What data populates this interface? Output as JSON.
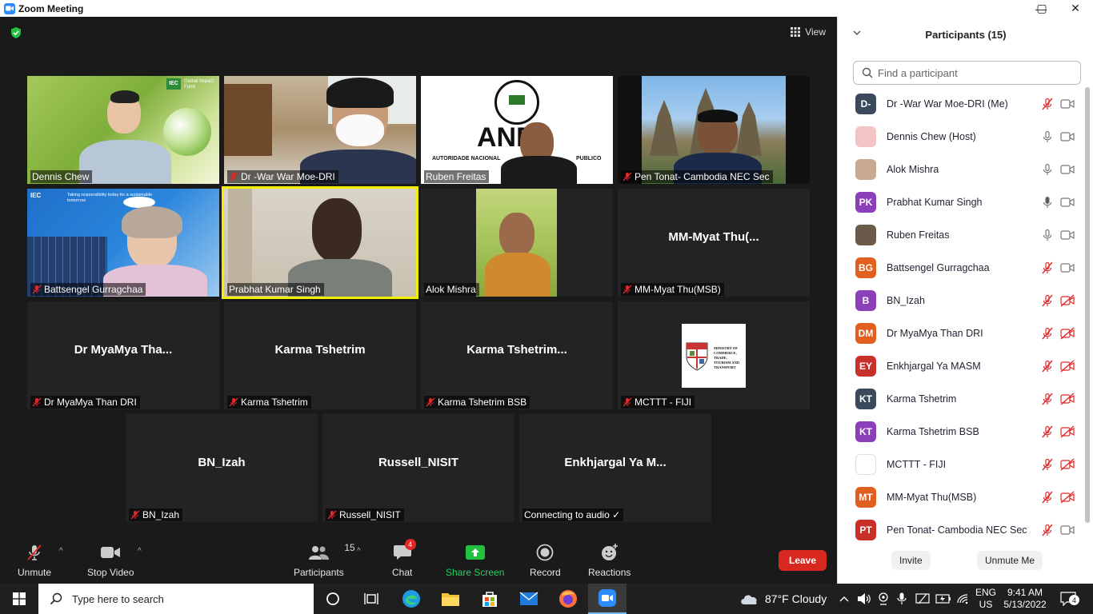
{
  "window": {
    "title": "Zoom Meeting",
    "minimize": "—",
    "maximize": "▢",
    "close": "✕"
  },
  "meeting": {
    "view_label": "View"
  },
  "tiles": [
    {
      "name": "Dennis Chew",
      "big": ""
    },
    {
      "name": "Dr -War War Moe-DRI",
      "big": ""
    },
    {
      "name": "Ruben Freitas",
      "big": ""
    },
    {
      "name": "Pen Tonat- Cambodia NEC Sec",
      "big": ""
    },
    {
      "name": "Battsengel Gurragchaa",
      "big": ""
    },
    {
      "name": "Prabhat Kumar Singh",
      "big": ""
    },
    {
      "name": "Alok Mishra",
      "big": ""
    },
    {
      "name": "MM-Myat Thu(MSB)",
      "big": "MM-Myat  Thu(..."
    },
    {
      "name": "Dr MyaMya Than DRI",
      "big": "Dr MyaMya  Tha..."
    },
    {
      "name": "Karma Tshetrim",
      "big": "Karma  Tshetrim"
    },
    {
      "name": "Karma Tshetrim BSB",
      "big": "Karma  Tshetrim..."
    },
    {
      "name": "MCTTT - FIJI",
      "big": ""
    },
    {
      "name": "BN_Izah",
      "big": "BN_Izah"
    },
    {
      "name": "Russell_NISIT",
      "big": "Russell_NISIT"
    },
    {
      "name": "Connecting to audio ✓",
      "big": "Enkhjargal  Ya  M..."
    }
  ],
  "tile_texts": {
    "iec_small": "IEC",
    "global_fund": "Global Impact Fund",
    "ane": "ANE",
    "ane_sub": "AUTORIDADE NACIONAL",
    "ane_sub2": "PUBLICO",
    "iec_banner": "Taking responsibility today for a sustainable tomorrow",
    "ministry": "MINISTRY OF COMMERCE, TRADE, TOURISM AND TRANSPORT"
  },
  "toolbar": {
    "unmute": "Unmute",
    "stop_video": "Stop Video",
    "participants": "Participants",
    "participants_count": "15",
    "chat": "Chat",
    "chat_badge": "4",
    "share_screen": "Share Screen",
    "record": "Record",
    "reactions": "Reactions",
    "leave": "Leave"
  },
  "panel": {
    "title": "Participants (15)",
    "search_placeholder": "Find a participant",
    "invite": "Invite",
    "unmute_me": "Unmute Me",
    "participants": [
      {
        "initials": "D-",
        "name": "Dr -War War Moe-DRI (Me)",
        "color": "#3a4a5c",
        "mic": "muted",
        "cam": "on"
      },
      {
        "initials": "",
        "name": "Dennis Chew (Host)",
        "color": "#f3c4c4",
        "mic": "on",
        "cam": "on"
      },
      {
        "initials": "",
        "name": "Alok Mishra",
        "color": "#c9a98f",
        "mic": "on",
        "cam": "on"
      },
      {
        "initials": "PK",
        "name": "Prabhat Kumar Singh",
        "color": "#8b3fb8",
        "mic": "active",
        "cam": "on"
      },
      {
        "initials": "",
        "name": "Ruben Freitas",
        "color": "#6b5a4a",
        "mic": "on",
        "cam": "on"
      },
      {
        "initials": "BG",
        "name": "Battsengel Gurragchaa",
        "color": "#e2601f",
        "mic": "muted",
        "cam": "on"
      },
      {
        "initials": "B",
        "name": "BN_Izah",
        "color": "#8b3fb8",
        "mic": "muted",
        "cam": "off"
      },
      {
        "initials": "DM",
        "name": "Dr MyaMya Than DRI",
        "color": "#e2601f",
        "mic": "muted",
        "cam": "off"
      },
      {
        "initials": "EY",
        "name": "Enkhjargal Ya MASM",
        "color": "#c8302a",
        "mic": "muted",
        "cam": "off"
      },
      {
        "initials": "KT",
        "name": "Karma Tshetrim",
        "color": "#3a4a5c",
        "mic": "muted",
        "cam": "off"
      },
      {
        "initials": "KT",
        "name": "Karma Tshetrim BSB",
        "color": "#8b3fb8",
        "mic": "muted",
        "cam": "off"
      },
      {
        "initials": "",
        "name": "MCTTT - FIJI",
        "color": "#ffffff",
        "mic": "muted",
        "cam": "off"
      },
      {
        "initials": "MT",
        "name": "MM-Myat Thu(MSB)",
        "color": "#e2601f",
        "mic": "muted",
        "cam": "off"
      },
      {
        "initials": "PT",
        "name": "Pen Tonat- Cambodia NEC Sec",
        "color": "#c8302a",
        "mic": "muted",
        "cam": "on"
      }
    ]
  },
  "taskbar": {
    "search_placeholder": "Type here to search",
    "weather": "87°F  Cloudy",
    "lang1": "ENG",
    "lang2": "US",
    "time": "9:41 AM",
    "date": "5/13/2022",
    "notifications": "4"
  }
}
